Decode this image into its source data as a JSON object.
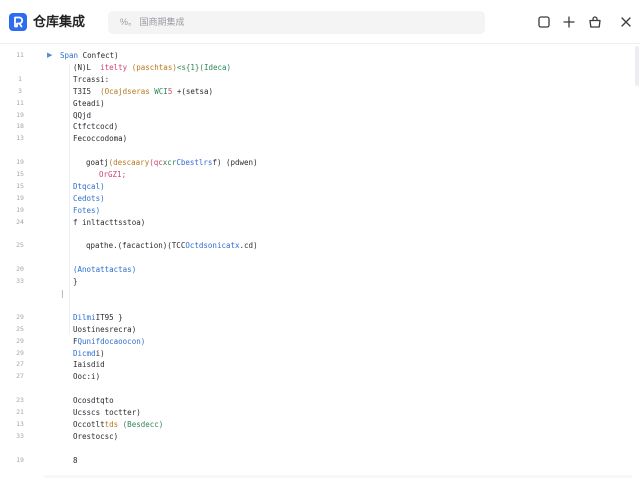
{
  "header": {
    "app_title": "仓库集成",
    "search_placeholder": "%。 国商期集成",
    "actions": [
      {
        "name": "copy-icon"
      },
      {
        "name": "add-icon"
      },
      {
        "name": "bag-icon"
      },
      {
        "name": "close-icon"
      }
    ]
  },
  "editor": {
    "lines": [
      {
        "n": "11",
        "indent": 0,
        "tokens": [
          {
            "t": "Span",
            "c": "tk-typ"
          },
          {
            "t": " Confect)",
            "c": "tk-txt"
          }
        ]
      },
      {
        "n": "",
        "indent": 1,
        "tokens": [
          {
            "t": "(N)L  ",
            "c": "tk-txt"
          },
          {
            "t": "itelty ",
            "c": "tk-num"
          },
          {
            "t": "(paschtas)",
            "c": "tk-str"
          },
          {
            "t": "<s{1}(Ideca)",
            "c": "tk-fn"
          }
        ]
      },
      {
        "n": "1",
        "indent": 1,
        "tokens": [
          {
            "t": "Trcassi:",
            "c": "tk-txt"
          }
        ]
      },
      {
        "n": "3",
        "indent": 1,
        "tokens": [
          {
            "t": "T3I5  ",
            "c": "tk-txt"
          },
          {
            "t": "(Ocajdseras ",
            "c": "tk-str"
          },
          {
            "t": "WCI",
            "c": "tk-fn"
          },
          {
            "t": "5 ",
            "c": "tk-num"
          },
          {
            "t": "+(setsa)",
            "c": "tk-txt"
          }
        ]
      },
      {
        "n": "11",
        "indent": 1,
        "tokens": [
          {
            "t": "Gteadi)",
            "c": "tk-txt"
          }
        ]
      },
      {
        "n": "19",
        "indent": 1,
        "tokens": [
          {
            "t": "QQjd",
            "c": "tk-txt"
          }
        ]
      },
      {
        "n": "18",
        "indent": 1,
        "tokens": [
          {
            "t": "Ctfctcocd)",
            "c": "tk-txt"
          }
        ]
      },
      {
        "n": "13",
        "indent": 1,
        "tokens": [
          {
            "t": "Fecoccodoma)",
            "c": "tk-txt"
          }
        ]
      },
      {
        "n": "",
        "indent": 0,
        "tokens": []
      },
      {
        "n": "19",
        "indent": 2,
        "tokens": [
          {
            "t": "goatj",
            "c": "tk-txt"
          },
          {
            "t": "(descaary",
            "c": "tk-str"
          },
          {
            "t": "(qc",
            "c": "tk-num"
          },
          {
            "t": "xcr",
            "c": "tk-fn"
          },
          {
            "t": "Cbestlrs",
            "c": "tk-typ"
          },
          {
            "t": "f) (pdwen)",
            "c": "tk-txt"
          }
        ]
      },
      {
        "n": "15",
        "indent": 3,
        "tokens": [
          {
            "t": "OrGZ1;",
            "c": "tk-num"
          }
        ]
      },
      {
        "n": "15",
        "indent": 1,
        "tokens": [
          {
            "t": "Dtqcal)",
            "c": "tk-typ"
          }
        ]
      },
      {
        "n": "19",
        "indent": 1,
        "tokens": [
          {
            "t": "Cedots)",
            "c": "tk-typ"
          }
        ]
      },
      {
        "n": "19",
        "indent": 1,
        "tokens": [
          {
            "t": "Fotes)",
            "c": "tk-typ"
          }
        ]
      },
      {
        "n": "24",
        "indent": 1,
        "tokens": [
          {
            "t": "f inltacttsstoa)",
            "c": "tk-txt"
          }
        ]
      },
      {
        "n": "",
        "indent": 0,
        "tokens": []
      },
      {
        "n": "25",
        "indent": 2,
        "tokens": [
          {
            "t": "qpathe.",
            "c": "tk-txt"
          },
          {
            "t": "(facaction)",
            "c": "tk-txt"
          },
          {
            "t": "(TCC",
            "c": "tk-txt"
          },
          {
            "t": "Octdsonicatx",
            "c": "tk-typ"
          },
          {
            "t": ".cd)",
            "c": "tk-txt"
          }
        ]
      },
      {
        "n": "",
        "indent": 0,
        "tokens": []
      },
      {
        "n": "20",
        "indent": 1,
        "tokens": [
          {
            "t": "(Anotattactas)",
            "c": "tk-typ"
          }
        ]
      },
      {
        "n": "33",
        "indent": 1,
        "tokens": [
          {
            "t": "}",
            "c": "tk-txt"
          }
        ]
      },
      {
        "n": "",
        "indent": 0,
        "tokens": [
          {
            "t": "|",
            "c": "tk-dim"
          }
        ]
      },
      {
        "n": "",
        "indent": 0,
        "tokens": []
      },
      {
        "n": "29",
        "indent": 1,
        "tokens": [
          {
            "t": "Dilmi",
            "c": "tk-typ"
          },
          {
            "t": "IT95 }",
            "c": "tk-txt"
          }
        ]
      },
      {
        "n": "25",
        "indent": 1,
        "tokens": [
          {
            "t": "Uostinesrecra)",
            "c": "tk-txt"
          }
        ]
      },
      {
        "n": "29",
        "indent": 1,
        "tokens": [
          {
            "t": "F",
            "c": "tk-txt"
          },
          {
            "t": "Qunifdocaoocon)",
            "c": "tk-typ"
          }
        ]
      },
      {
        "n": "29",
        "indent": 1,
        "tokens": [
          {
            "t": "Dicmd",
            "c": "tk-typ"
          },
          {
            "t": "i)",
            "c": "tk-txt"
          }
        ]
      },
      {
        "n": "27",
        "indent": 1,
        "tokens": [
          {
            "t": "Iaisdid",
            "c": "tk-txt"
          }
        ]
      },
      {
        "n": "27",
        "indent": 1,
        "tokens": [
          {
            "t": "Ooc:i)",
            "c": "tk-txt"
          }
        ]
      },
      {
        "n": "",
        "indent": 0,
        "tokens": []
      },
      {
        "n": "23",
        "indent": 1,
        "tokens": [
          {
            "t": "Ocosdtqto",
            "c": "tk-txt"
          }
        ]
      },
      {
        "n": "21",
        "indent": 1,
        "tokens": [
          {
            "t": "Ucsscs toctter)",
            "c": "tk-txt"
          }
        ]
      },
      {
        "n": "13",
        "indent": 1,
        "tokens": [
          {
            "t": "Occotlt",
            "c": "tk-txt"
          },
          {
            "t": "tds ",
            "c": "tk-str"
          },
          {
            "t": "(Besdecc)",
            "c": "tk-fn"
          }
        ]
      },
      {
        "n": "33",
        "indent": 1,
        "tokens": [
          {
            "t": "Orestocsc)",
            "c": "tk-txt"
          }
        ]
      },
      {
        "n": "",
        "indent": 0,
        "tokens": []
      },
      {
        "n": "19",
        "indent": 1,
        "tokens": [
          {
            "t": "8",
            "c": "tk-txt"
          }
        ]
      }
    ]
  }
}
